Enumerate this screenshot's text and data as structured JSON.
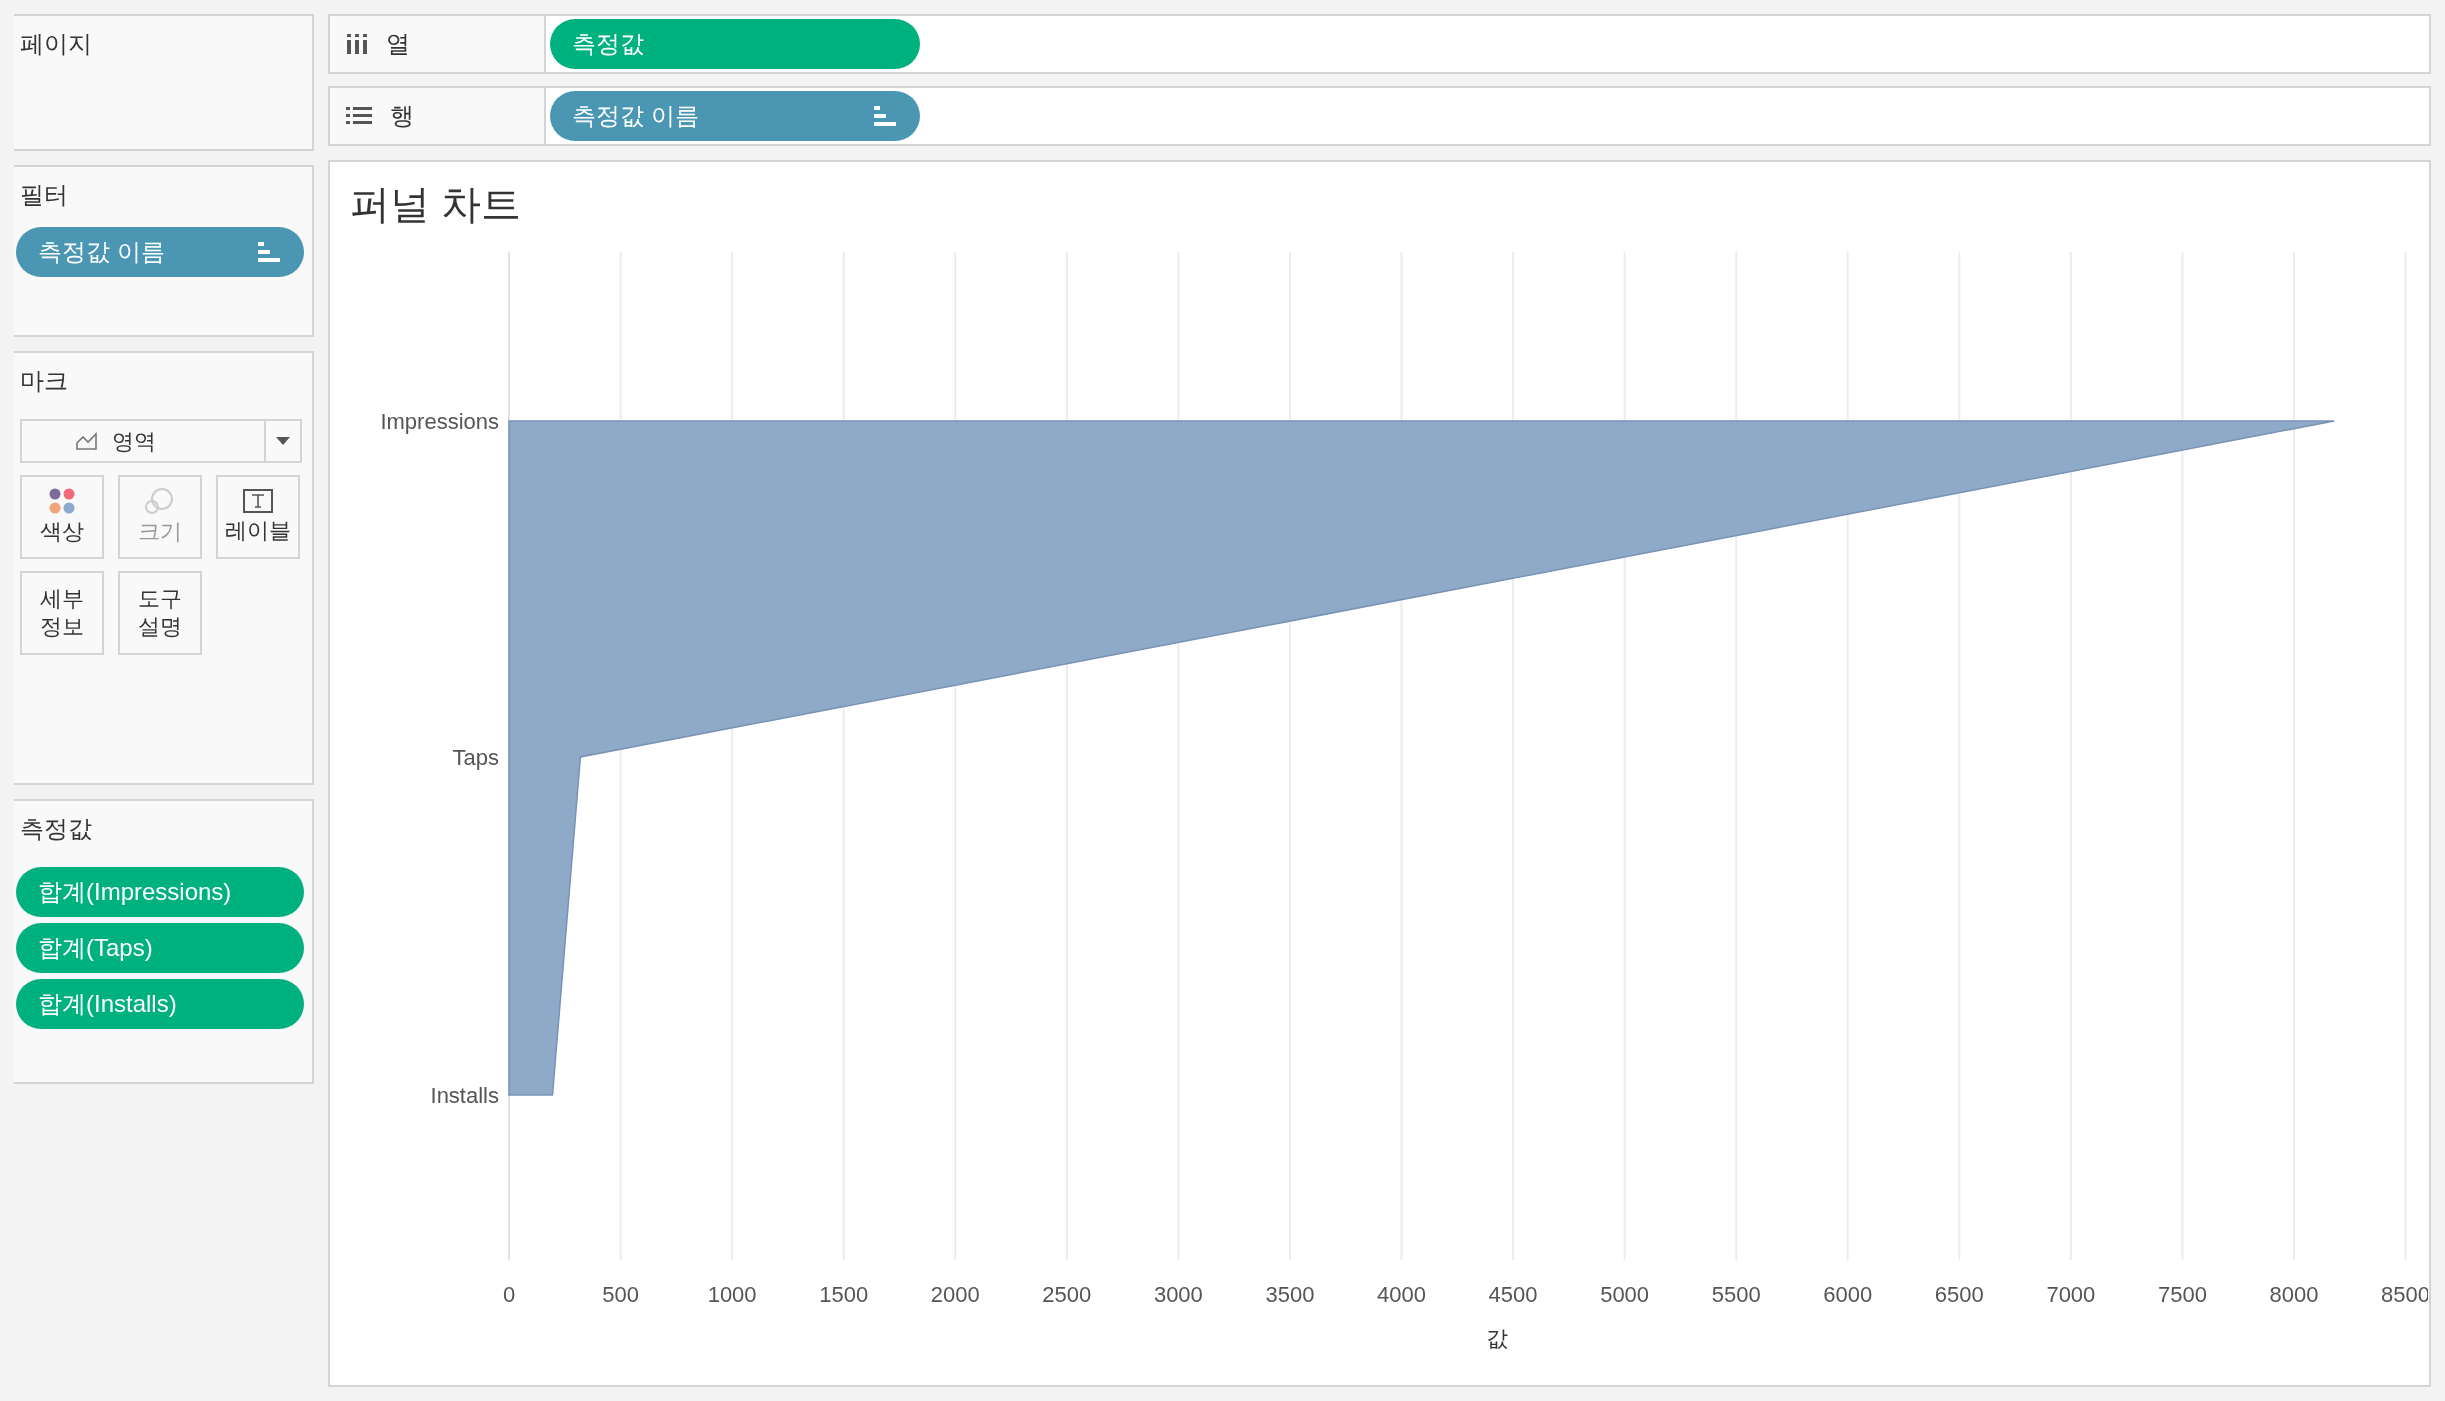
{
  "pages_card": {
    "title": "페이지"
  },
  "filters_card": {
    "title": "필터",
    "pills": [
      {
        "label": "측정값 이름",
        "kind": "dimension",
        "sorted": true
      }
    ]
  },
  "marks_card": {
    "title": "마크",
    "mark_type": "영역",
    "buttons": [
      {
        "label": "색상",
        "kind": "color",
        "disabled": false
      },
      {
        "label": "크기",
        "kind": "size",
        "disabled": true
      },
      {
        "label": "레이블",
        "kind": "label",
        "disabled": false
      },
      {
        "label": "세부 정보",
        "kind": "detail",
        "disabled": false
      },
      {
        "label": "도구 설명",
        "kind": "tooltip",
        "disabled": false
      }
    ]
  },
  "measure_values_card": {
    "title": "측정값",
    "pills": [
      {
        "label": "합계(Impressions)",
        "kind": "measure",
        "sorted": false
      },
      {
        "label": "합계(Taps)",
        "kind": "measure",
        "sorted": false
      },
      {
        "label": "합계(Installs)",
        "kind": "measure",
        "sorted": false
      }
    ]
  },
  "shelves": [
    {
      "kind": "columns",
      "label": "열",
      "pills": [
        {
          "label": "측정값",
          "kind": "measure",
          "sorted": false
        }
      ]
    },
    {
      "kind": "rows",
      "label": "행",
      "pills": [
        {
          "label": "측정값 이름",
          "kind": "dimension",
          "sorted": true
        }
      ]
    }
  ],
  "view": {
    "title": "퍼널 차트",
    "chart_data": {
      "type": "area",
      "orientation": "horizontal",
      "xlabel": "값",
      "categories": [
        "Impressions",
        "Taps",
        "Installs"
      ],
      "series": [
        {
          "color": "#8faac8",
          "values": [
            8180,
            320,
            195
          ]
        }
      ],
      "grid": true,
      "xlim": [
        0,
        8500
      ],
      "xticks": [
        0,
        500,
        1000,
        1500,
        2000,
        2500,
        3000,
        3500,
        4000,
        4500,
        5000,
        5500,
        6000,
        6500,
        7000,
        7500,
        8000,
        8500
      ]
    }
  }
}
